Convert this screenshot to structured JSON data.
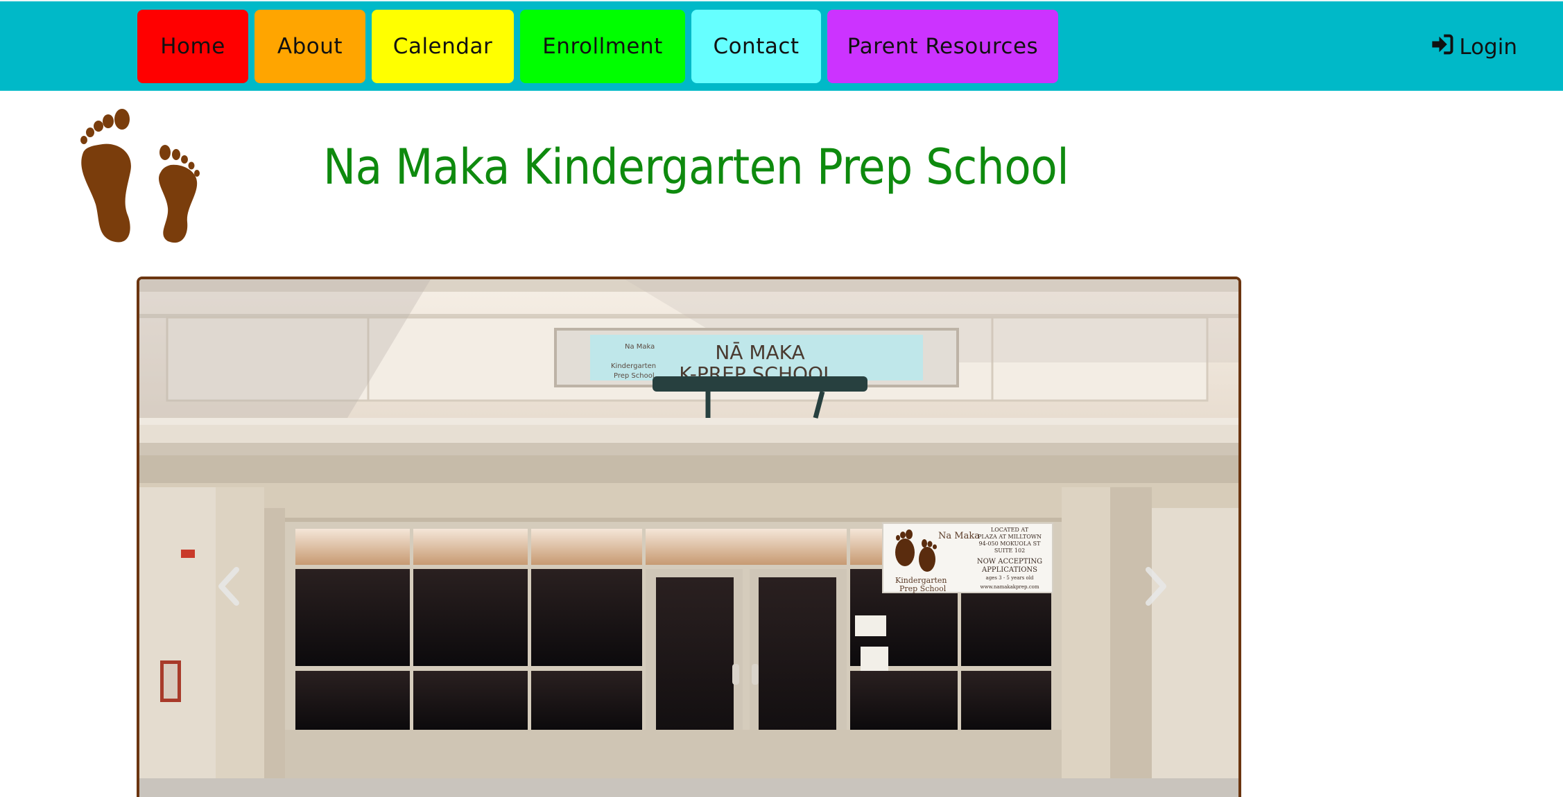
{
  "nav": {
    "items": [
      {
        "label": "Home",
        "color": "#ff0000"
      },
      {
        "label": "About",
        "color": "#ffa500"
      },
      {
        "label": "Calendar",
        "color": "#ffff00"
      },
      {
        "label": "Enrollment",
        "color": "#00ff00"
      },
      {
        "label": "Contact",
        "color": "#66ffff"
      },
      {
        "label": "Parent Resources",
        "color": "#cc33ff"
      }
    ],
    "login_label": "Login",
    "bar_color": "#00b9c8"
  },
  "header": {
    "title": "Na Maka Kindergarten Prep School",
    "title_color": "#0e8a0e",
    "logo_icon": "footprints-icon",
    "logo_color": "#7a3d0c"
  },
  "carousel": {
    "border_color": "#6b3510",
    "prev_icon": "chevron-left-icon",
    "next_icon": "chevron-right-icon",
    "slide": {
      "storefront_sign_line1": "NĀ MAKA",
      "storefront_sign_line2": "K-PREP SCHOOL",
      "sign_small_line1": "Na Maka",
      "sign_small_line2": "Kindergarten",
      "sign_small_line3": "Prep School",
      "banner_located": "LOCATED AT",
      "banner_plaza": "PLAZA AT MILLTOWN",
      "banner_address": "94-050 MOKUOLA ST",
      "banner_suite": "SUITE 102",
      "banner_now": "NOW ACCEPTING",
      "banner_apps": "APPLICATIONS",
      "banner_ages": "ages 3 - 5 years old",
      "banner_web": "www.namakakprep.com",
      "banner_name1": "Na Maka",
      "banner_name2": "Kindergarten",
      "banner_name3": "Prep School"
    }
  }
}
